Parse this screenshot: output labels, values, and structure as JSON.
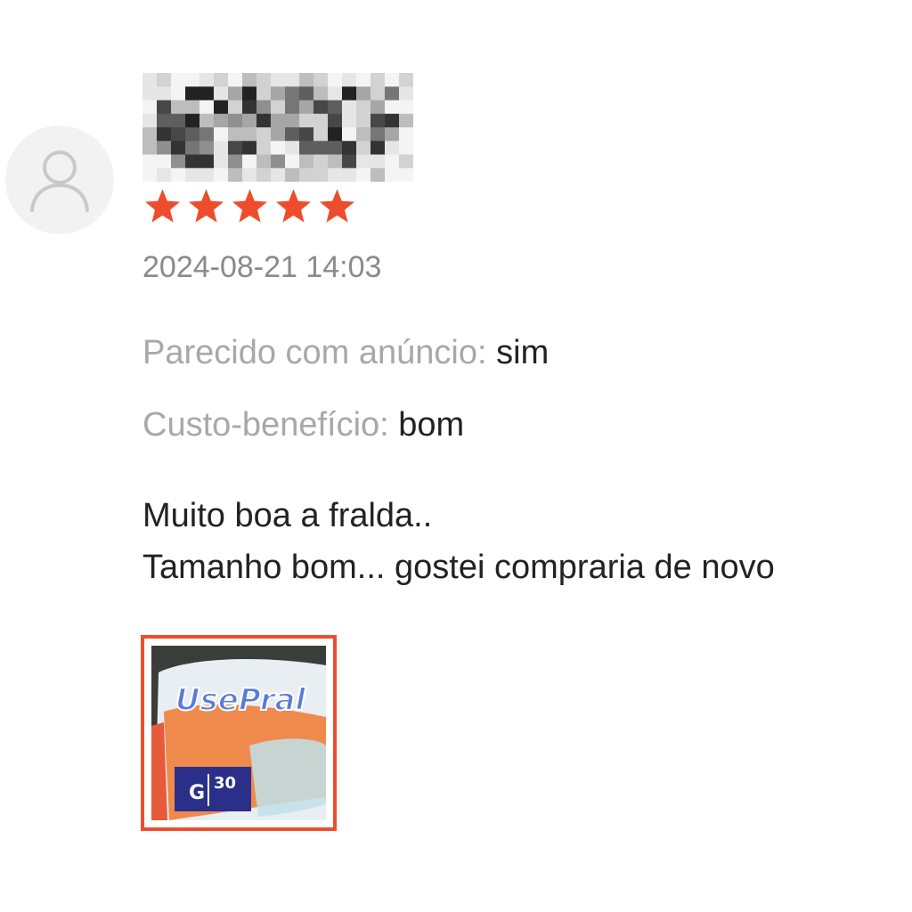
{
  "review": {
    "username": "",
    "rating": 5,
    "rating_max": 5,
    "star_color": "#ee4d2d",
    "date": "2024-08-21 14:03",
    "attributes": [
      {
        "label": "Parecido com anúncio:",
        "value": "sim"
      },
      {
        "label": "Custo-benefício:",
        "value": "bom"
      }
    ],
    "comment_lines": [
      "Muito boa a fralda..",
      "Tamanho bom... gostei compraria de novo"
    ],
    "photo": {
      "brand_text": "UsePral",
      "size_letter": "G",
      "count": "30",
      "border_color": "#ee4d2d"
    },
    "icons": {
      "avatar": "user-avatar-icon",
      "star": "star-icon"
    }
  }
}
